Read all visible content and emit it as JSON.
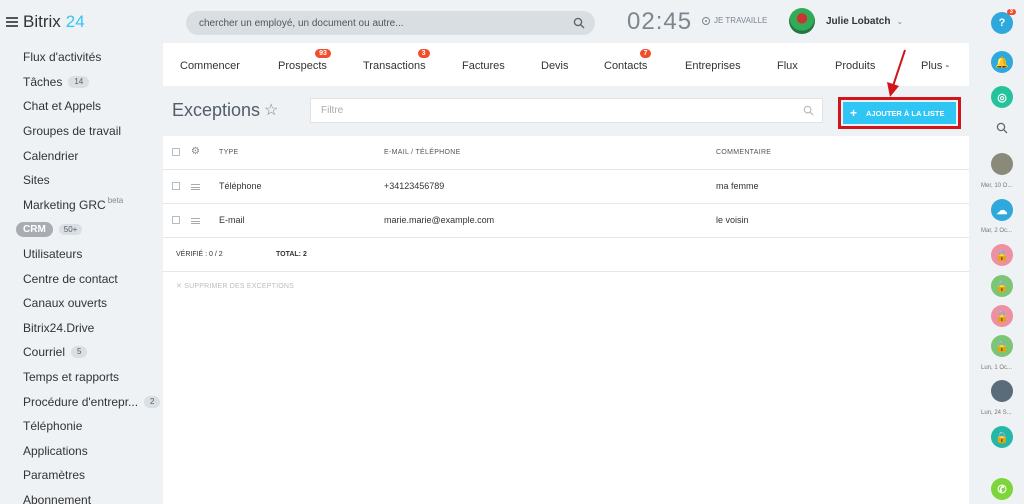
{
  "brand": {
    "name": "Bitrix",
    "number": "24"
  },
  "header": {
    "search_placeholder": "chercher un employé, un document ou autre...",
    "time": "02:45",
    "work_status": "JE TRAVAILLE",
    "user_name": "Julie Lobatch"
  },
  "sidebar": {
    "items": [
      {
        "label": "Flux d'activités"
      },
      {
        "label": "Tâches",
        "count": "14"
      },
      {
        "label": "Chat et Appels"
      },
      {
        "label": "Groupes de travail"
      },
      {
        "label": "Calendrier"
      },
      {
        "label": "Sites"
      },
      {
        "label": "Marketing GRC",
        "sup": "beta"
      },
      {
        "label": "CRM",
        "count": "50+"
      },
      {
        "label": "Utilisateurs"
      },
      {
        "label": "Centre de contact"
      },
      {
        "label": "Canaux ouverts"
      },
      {
        "label": "Bitrix24.Drive"
      },
      {
        "label": "Courriel",
        "count": "5"
      },
      {
        "label": "Temps et rapports"
      },
      {
        "label": "Procédure d'entrepr...",
        "count": "2"
      },
      {
        "label": "Téléphonie"
      },
      {
        "label": "Applications"
      },
      {
        "label": "Paramètres"
      },
      {
        "label": "Abonnement"
      }
    ]
  },
  "tabs": [
    {
      "label": "Commencer"
    },
    {
      "label": "Prospects",
      "badge": "93"
    },
    {
      "label": "Transactions",
      "badge": "3"
    },
    {
      "label": "Factures"
    },
    {
      "label": "Devis"
    },
    {
      "label": "Contacts",
      "badge": "7"
    },
    {
      "label": "Entreprises"
    },
    {
      "label": "Flux"
    },
    {
      "label": "Produits"
    },
    {
      "label": "Plus -"
    }
  ],
  "page": {
    "title": "Exceptions",
    "filter_placeholder": "Filtre",
    "add_button": "AJOUTER À LA LISTE"
  },
  "table": {
    "columns": [
      "TYPE",
      "E-MAIL / TÉLÉPHONE",
      "COMMENTAIRE"
    ],
    "rows": [
      {
        "type": "Téléphone",
        "contact": "+34123456789",
        "comment": "ma femme"
      },
      {
        "type": "E-mail",
        "contact": "marie.marie@example.com",
        "comment": "le voisin"
      }
    ],
    "verified_label": "VÉRIFIÉ : 0 / 2",
    "total_label": "TOTAL: 2",
    "delete_label": "SUPPRIMER DES EXCEPTIONS"
  },
  "right_bar": {
    "help_badge": "3",
    "labels": [
      "Mer, 10 O...",
      "Mar, 2 Oc...",
      "Lun, 1 Oc...",
      "Lun, 24 S..."
    ]
  },
  "colors": {
    "accent": "#2fc6f6",
    "badge": "#f34c2b",
    "highlight": "#d3151b"
  }
}
